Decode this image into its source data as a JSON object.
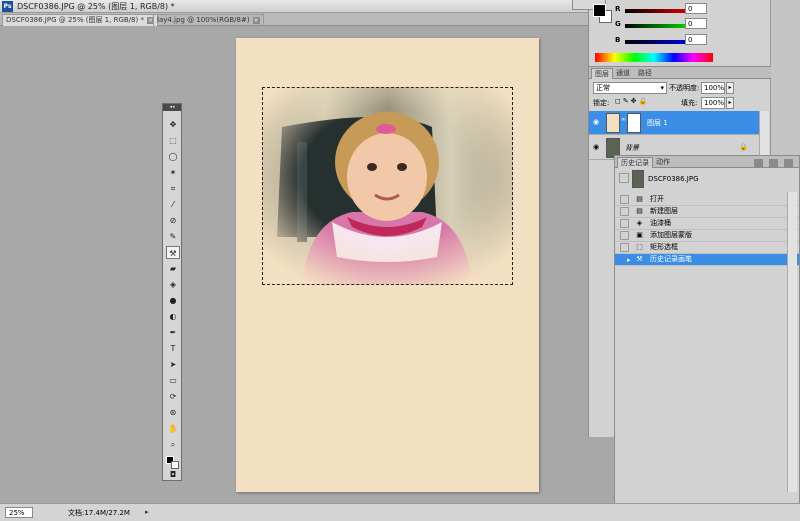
{
  "app": {
    "logo": "Ps",
    "title": "DSCF0386.JPG @ 25% (图层 1, RGB/8) *"
  },
  "tabs": [
    {
      "label": "DSCF0386.JPG @ 25% (图层 1, RGB/8) *",
      "active": true
    },
    {
      "label": "lay4.jpg @ 100%(RGB/8#)",
      "active": false
    }
  ],
  "color_panel": {
    "channels": [
      {
        "label": "R",
        "value": "0",
        "color": "#d40000"
      },
      {
        "label": "G",
        "value": "0",
        "color": "#00a000"
      },
      {
        "label": "B",
        "value": "0",
        "color": "#0000d0"
      }
    ],
    "foreground": "#000000",
    "background": "#ffffff"
  },
  "layers_panel": {
    "tabs": [
      "图层",
      "通道",
      "路径"
    ],
    "blend_mode": "正常",
    "opacity_label": "不透明度:",
    "opacity_value": "100%",
    "lock_label": "锁定:",
    "fill_label": "填充:",
    "fill_value": "100%",
    "layers": [
      {
        "name": "图层 1",
        "active": true
      },
      {
        "name": "背景",
        "active": false
      }
    ]
  },
  "history_panel": {
    "tabs": [
      "历史记录",
      "动作"
    ],
    "snapshot": "DSCF0386.JPG",
    "items": [
      {
        "label": "打开",
        "icon": "document-icon",
        "active": false
      },
      {
        "label": "新建图层",
        "icon": "new-layer-icon",
        "active": false
      },
      {
        "label": "油漆桶",
        "icon": "paint-bucket-icon",
        "active": false
      },
      {
        "label": "添加图层蒙版",
        "icon": "mask-icon",
        "active": false
      },
      {
        "label": "矩形选框",
        "icon": "rect-marquee-icon",
        "active": false
      },
      {
        "label": "历史记录画笔",
        "icon": "history-brush-icon",
        "active": true
      }
    ]
  },
  "status": {
    "zoom": "25%",
    "doc_info": "文档:17.4M/27.2M"
  },
  "canvas": {
    "color": "#f3dfc2"
  },
  "accent": "#3b8ee6"
}
